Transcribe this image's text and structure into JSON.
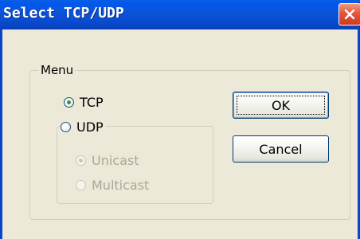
{
  "window": {
    "title": "Select TCP/UDP",
    "close_icon": "close-icon"
  },
  "menu_group": {
    "label": "Menu",
    "options": [
      {
        "label": "TCP",
        "selected": true,
        "enabled": true
      },
      {
        "label": "UDP",
        "selected": false,
        "enabled": true
      }
    ]
  },
  "udp_group": {
    "options": [
      {
        "label": "Unicast",
        "selected": true,
        "enabled": false
      },
      {
        "label": "Multicast",
        "selected": false,
        "enabled": false
      }
    ]
  },
  "buttons": {
    "ok_label": "OK",
    "cancel_label": "Cancel"
  },
  "colors": {
    "titlebar": "#0a4fd4",
    "dialog_bg": "#ece9d8",
    "radio_dot": "#2f9a24",
    "disabled_text": "#aca899"
  }
}
